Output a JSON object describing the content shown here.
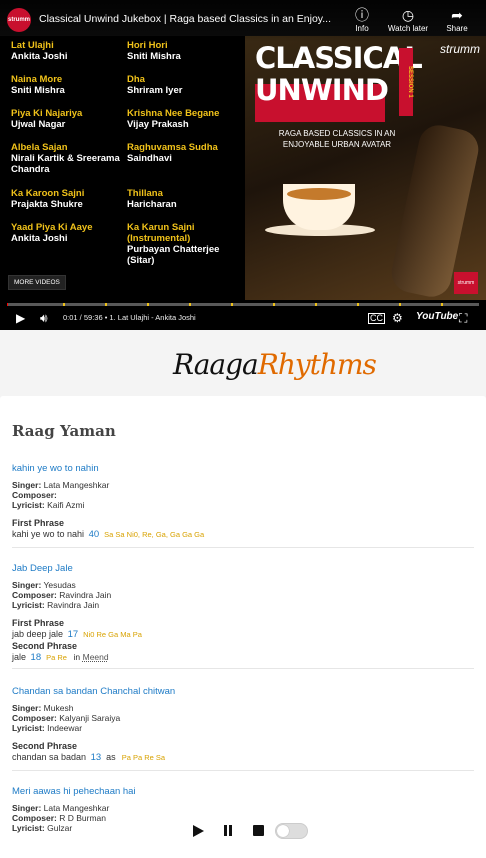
{
  "video": {
    "channel_logo_text": "strumm",
    "title": "Classical Unwind Jukebox | Raga based Classics in an Enjoy...",
    "buttons": {
      "info": "Info",
      "watch_later": "Watch later",
      "share": "Share"
    },
    "tracks_left": [
      {
        "title": "Lat Ulajhi",
        "artist": "Ankita Joshi"
      },
      {
        "title": "Naina More",
        "artist": "Sniti Mishra"
      },
      {
        "title": "Piya Ki Najariya",
        "artist": "Ujwal Nagar"
      },
      {
        "title": "Albela Sajan",
        "artist": "Nirali Kartik & Sreerama Chandra"
      },
      {
        "title": "Ka Karoon Sajni",
        "artist": "Prajakta Shukre"
      },
      {
        "title": "Yaad Piya Ki Aaye",
        "artist": "Ankita Joshi"
      }
    ],
    "tracks_right": [
      {
        "title": "Hori Hori",
        "artist": "Sniti Mishra"
      },
      {
        "title": "Dha",
        "artist": "Shriram Iyer"
      },
      {
        "title": "Krishna Nee Begane",
        "artist": "Vijay Prakash"
      },
      {
        "title": "Raghuvamsa Sudha",
        "artist": "Saindhavi"
      },
      {
        "title": "Thillana",
        "artist": "Haricharan"
      },
      {
        "title": "Ka Karun Sajni (Instrumental)",
        "artist": "Purbayan Chatterjee (Sitar)"
      }
    ],
    "more_videos": "MORE VIDEOS",
    "art": {
      "line1": "CLASSICAL",
      "line2": "UNWIND",
      "session": "SESSION 1",
      "brand": "strumm",
      "tagline": "RAGA BASED CLASSICS IN AN ENJOYABLE URBAN AVATAR",
      "logo_text": "strumm"
    },
    "time": "0:01 / 59:36",
    "chapter": "• 1. Lat Ulajhi - Ankita Joshi",
    "youtube_label": "YouTube",
    "progress_played": 0.0003,
    "icons": {
      "play": "play-icon",
      "volume": "volume-icon",
      "cc": "cc-icon",
      "settings": "gear-icon",
      "fullscreen": "fullscreen-icon"
    }
  },
  "brand": {
    "part1": "Raaga",
    "part2": "Rhythms"
  },
  "raag": {
    "title": "Raag Yaman"
  },
  "labels": {
    "singer": "Singer:",
    "composer": "Composer:",
    "lyricist": "Lyricist:",
    "first_phrase": "First Phrase",
    "second_phrase": "Second Phrase"
  },
  "songs": [
    {
      "name": "kahin ye wo to nahin",
      "singer": "Lata Mangeshkar",
      "composer": "",
      "lyricist": "Kaifi Azmi",
      "first_text": "kahi ye wo to nahi",
      "first_num": "40",
      "first_notes": "Sa Sa Ni0, Re, Ga, Ga Ga Ga"
    },
    {
      "name": "Jab Deep Jale",
      "singer": "Yesudas",
      "composer": "Ravindra Jain",
      "lyricist": "Ravindra Jain",
      "first_text": "jab deep jale",
      "first_num": "17",
      "first_notes": "Ni0 Re Ga Ma Pa",
      "second_text": "jale",
      "second_num": "18",
      "second_notes": "Pa Re",
      "second_in": "in",
      "second_term": "Meend"
    },
    {
      "name": "Chandan sa bandan Chanchal chitwan",
      "singer": "Mukesh",
      "composer": "Kalyanji Saraiya",
      "lyricist": "Indeewar",
      "second_text": "chandan sa badan",
      "second_num": "13",
      "second_as": "as",
      "second_notes": "Pa Pa Re Sa"
    },
    {
      "name": "Meri aawas hi pehechaan hai",
      "singer": "Lata Mangeshkar",
      "composer": "R D Burman",
      "lyricist": "Gulzar"
    }
  ],
  "player": {
    "toggle_on": false
  }
}
